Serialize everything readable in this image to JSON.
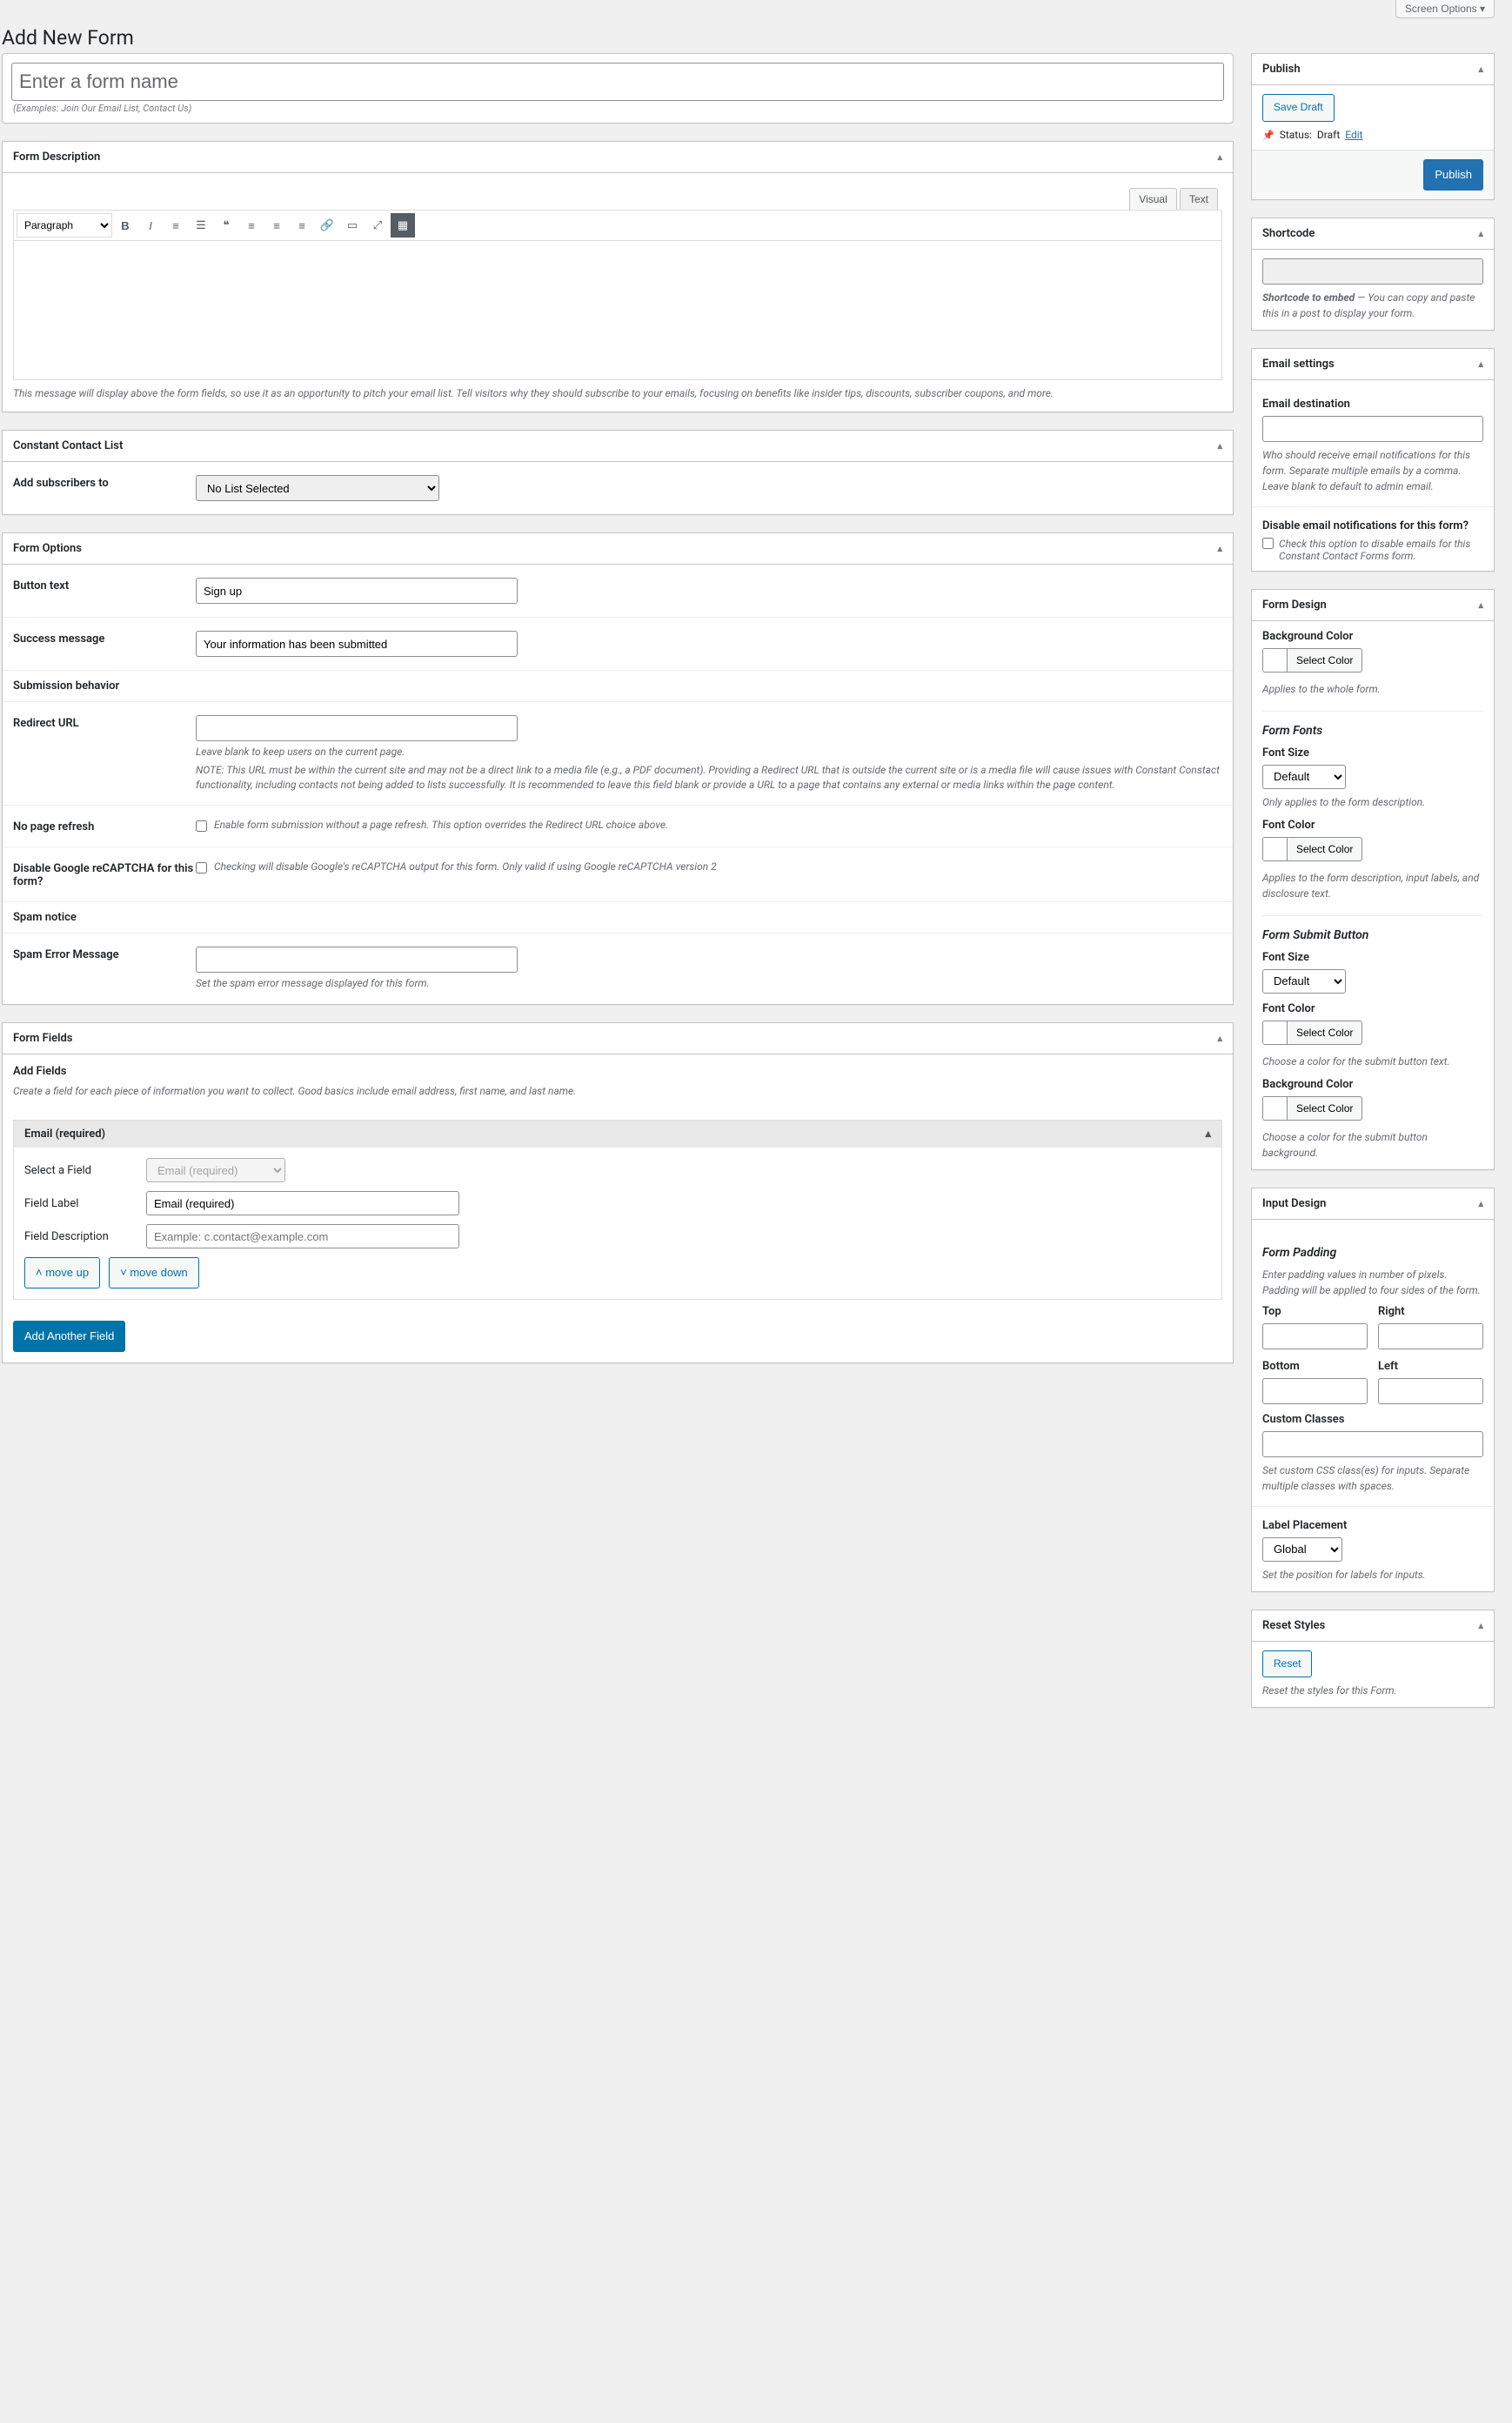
{
  "screen_options": "Screen Options",
  "page_title": "Add New Form",
  "title_placeholder": "Enter a form name",
  "title_prompt": "(Examples: Join Our Email List, Contact Us)",
  "desc": {
    "title": "Form Description",
    "visual": "Visual",
    "text": "Text",
    "paragraph": "Paragraph",
    "hint": "This message will display above the form fields, so use it as an opportunity to pitch your email list. Tell visitors why they should subscribe to your emails, focusing on benefits like insider tips, discounts, subscriber coupons, and more."
  },
  "cc_list": {
    "title": "Constant Contact List",
    "label": "Add subscribers to",
    "value": "No List Selected"
  },
  "options": {
    "title": "Form Options",
    "button_text_label": "Button text",
    "button_text_value": "Sign up",
    "success_label": "Success message",
    "success_value": "Your information has been submitted",
    "sub_behavior": "Submission behavior",
    "redirect_label": "Redirect URL",
    "redirect_hint1": "Leave blank to keep users on the current page.",
    "redirect_hint2": "NOTE: This URL must be within the current site and may not be a direct link to a media file (e.g., a PDF document). Providing a Redirect URL that is outside the current site or is a media file will cause issues with Constant Constact functionality, including contacts not being added to lists successfully. It is recommended to leave this field blank or provide a URL to a page that contains any external or media links within the page content.",
    "no_refresh_label": "No page refresh",
    "no_refresh_hint": "Enable form submission without a page refresh. This option overrides the Redirect URL choice above.",
    "recaptcha_label": "Disable Google reCAPTCHA for this form?",
    "recaptcha_hint": "Checking will disable Google's reCAPTCHA output for this form. Only valid if using Google reCAPTCHA version 2",
    "spam_notice_label": "Spam notice",
    "spam_error_label": "Spam Error Message",
    "spam_error_hint": "Set the spam error message displayed for this form."
  },
  "fields": {
    "title": "Form Fields",
    "add_heading": "Add Fields",
    "add_hint": "Create a field for each piece of information you want to collect. Good basics include email address, first name, and last name.",
    "block_title": "Email (required)",
    "select_label": "Select a Field",
    "select_value": "Email (required)",
    "label_label": "Field Label",
    "label_value": "Email (required)",
    "desc_label": "Field Description",
    "desc_placeholder": "Example: c.contact@example.com",
    "move_up": "move up",
    "move_down": "move down",
    "add_another": "Add Another Field"
  },
  "publish": {
    "title": "Publish",
    "save_draft": "Save Draft",
    "status_label": "Status:",
    "status_value": "Draft",
    "edit": "Edit",
    "publish_btn": "Publish"
  },
  "shortcode": {
    "title": "Shortcode",
    "hint_strong": "Shortcode to embed",
    "hint_rest": " — You can copy and paste this in a post to display your form."
  },
  "email": {
    "title": "Email settings",
    "dest_label": "Email destination",
    "dest_hint": "Who should receive email notifications for this form. Separate multiple emails by a comma. Leave blank to default to admin email.",
    "disable_label": "Disable email notifications for this form?",
    "disable_hint": "Check this option to disable emails for this Constant Contact Forms form."
  },
  "design": {
    "title": "Form Design",
    "bg_label": "Background Color",
    "select_color": "Select Color",
    "bg_hint": "Applies to the whole form.",
    "fonts_section": "Form Fonts",
    "font_size_label": "Font Size",
    "default": "Default",
    "font_size_hint": "Only applies to the form description.",
    "font_color_label": "Font Color",
    "font_color_hint": "Applies to the form description, input labels, and disclosure text.",
    "submit_section": "Form Submit Button",
    "submit_font_size_label": "Font Size",
    "submit_font_color_label": "Font Color",
    "submit_font_color_hint": "Choose a color for the submit button text.",
    "submit_bg_label": "Background Color",
    "submit_bg_hint": "Choose a color for the submit button background."
  },
  "input_design": {
    "title": "Input Design",
    "padding_section": "Form Padding",
    "padding_hint": "Enter padding values in number of pixels. Padding will be applied to four sides of the form.",
    "top": "Top",
    "right": "Right",
    "bottom": "Bottom",
    "left": "Left",
    "custom_classes": "Custom Classes",
    "custom_classes_hint": "Set custom CSS class(es) for inputs. Separate multiple classes with spaces.",
    "label_placement": "Label Placement",
    "global": "Global",
    "label_placement_hint": "Set the position for labels for inputs."
  },
  "reset": {
    "title": "Reset Styles",
    "btn": "Reset",
    "hint": "Reset the styles for this Form."
  }
}
